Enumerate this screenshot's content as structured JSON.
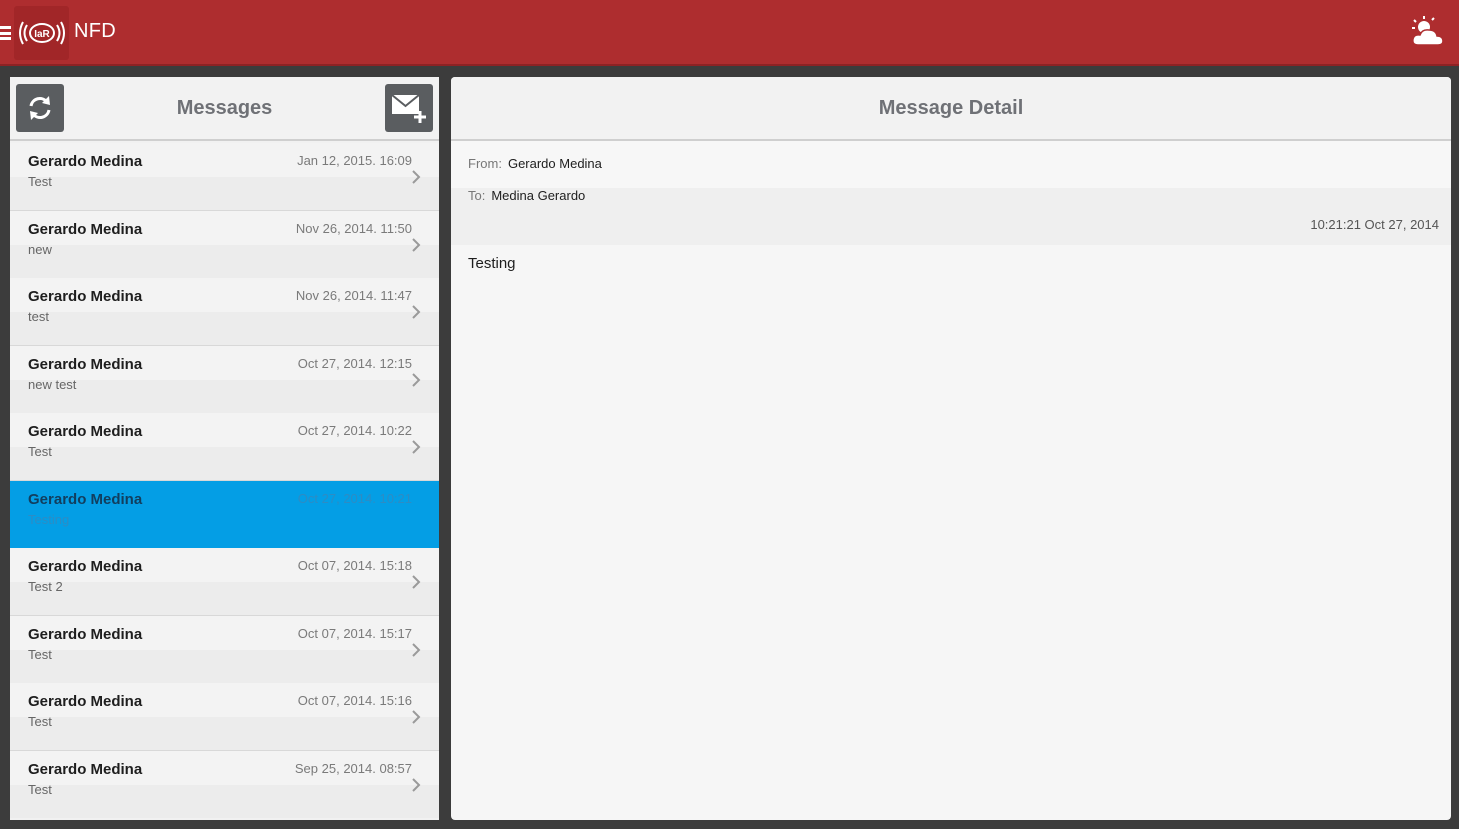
{
  "app": {
    "title": "NFD",
    "logo_text": "IaR"
  },
  "messages_panel": {
    "title": "Messages",
    "items": [
      {
        "sender": "Gerardo Medina",
        "date": "Jan 12, 2015. 16:09",
        "subject": "Test",
        "selected": false
      },
      {
        "sender": "Gerardo Medina",
        "date": "Nov 26, 2014. 11:50",
        "subject": "new",
        "selected": false
      },
      {
        "sender": "Gerardo Medina",
        "date": "Nov 26, 2014. 11:47",
        "subject": "test",
        "selected": false
      },
      {
        "sender": "Gerardo Medina",
        "date": "Oct 27, 2014. 12:15",
        "subject": "new test",
        "selected": false
      },
      {
        "sender": "Gerardo Medina",
        "date": "Oct 27, 2014. 10:22",
        "subject": "Test",
        "selected": false
      },
      {
        "sender": "Gerardo Medina",
        "date": "Oct 27, 2014. 10:21",
        "subject": "Testing",
        "selected": true
      },
      {
        "sender": "Gerardo Medina",
        "date": "Oct 07, 2014. 15:18",
        "subject": "Test 2",
        "selected": false
      },
      {
        "sender": "Gerardo Medina",
        "date": "Oct 07, 2014. 15:17",
        "subject": "Test",
        "selected": false
      },
      {
        "sender": "Gerardo Medina",
        "date": "Oct 07, 2014. 15:16",
        "subject": "Test",
        "selected": false
      },
      {
        "sender": "Gerardo Medina",
        "date": "Sep 25, 2014. 08:57",
        "subject": "Test",
        "selected": false
      }
    ]
  },
  "detail_panel": {
    "title": "Message Detail",
    "from_label": "From:",
    "from_value": "Gerardo Medina",
    "to_label": "To:",
    "to_value": "Medina Gerardo",
    "timestamp": "10:21:21 Oct 27, 2014",
    "body": "Testing"
  },
  "colors": {
    "topbar": "#ae2d2f",
    "selected_row": "#049ee5",
    "button_bg": "#5a5d60"
  }
}
